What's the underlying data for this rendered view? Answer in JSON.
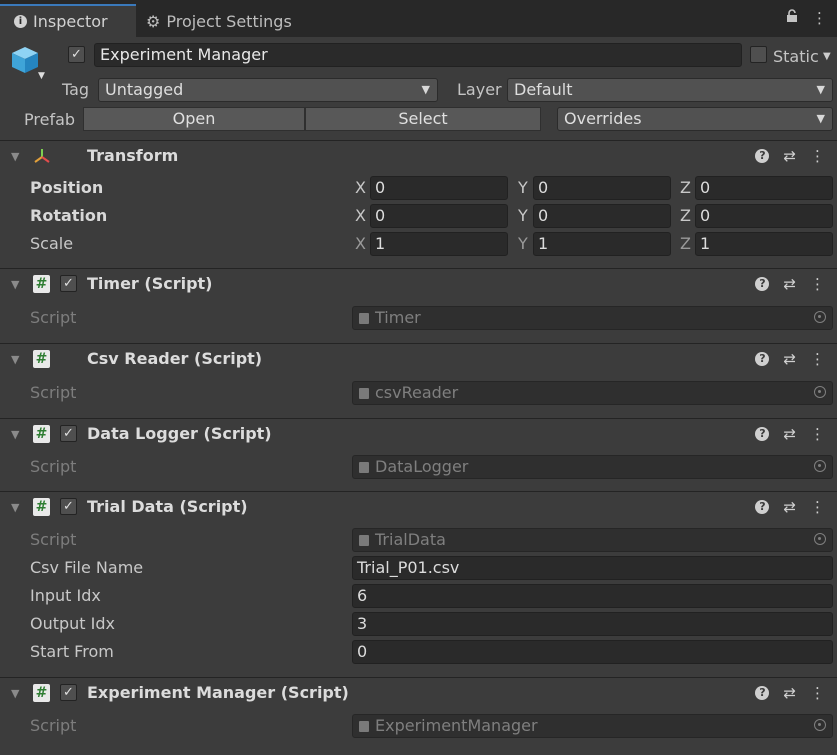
{
  "tabs": [
    {
      "label": "Inspector",
      "icon": "info-icon"
    },
    {
      "label": "Project Settings",
      "icon": "gear-icon"
    }
  ],
  "gameobject": {
    "name": "Experiment Manager",
    "active": true,
    "static_label": "Static",
    "tag_label": "Tag",
    "tag_value": "Untagged",
    "layer_label": "Layer",
    "layer_value": "Default",
    "prefab_label": "Prefab",
    "open_label": "Open",
    "select_label": "Select",
    "overrides_label": "Overrides"
  },
  "transform": {
    "title": "Transform",
    "position_label": "Position",
    "rotation_label": "Rotation",
    "scale_label": "Scale",
    "axes": {
      "x": "X",
      "y": "Y",
      "z": "Z"
    },
    "position": {
      "x": "0",
      "y": "0",
      "z": "0"
    },
    "rotation": {
      "x": "0",
      "y": "0",
      "z": "0"
    },
    "scale": {
      "x": "1",
      "y": "1",
      "z": "1"
    }
  },
  "script_label": "Script",
  "components": {
    "timer": {
      "title": "Timer (Script)",
      "enabled": true,
      "script": "Timer"
    },
    "csv_reader": {
      "title": "Csv Reader (Script)",
      "script": "csvReader"
    },
    "data_logger": {
      "title": "Data Logger (Script)",
      "enabled": true,
      "script": "DataLogger"
    },
    "trial_data": {
      "title": "Trial Data (Script)",
      "enabled": true,
      "script": "TrialData",
      "csv_file_name_label": "Csv File Name",
      "csv_file_name": "Trial_P01.csv",
      "input_idx_label": "Input Idx",
      "input_idx": "6",
      "output_idx_label": "Output Idx",
      "output_idx": "3",
      "start_from_label": "Start From",
      "start_from": "0"
    },
    "experiment_manager": {
      "title": "Experiment Manager (Script)",
      "enabled": true,
      "script": "ExperimentManager"
    }
  },
  "colors": {
    "background": "#383838",
    "accent_tab": "#3a79bb",
    "field": "#2a2a2a"
  }
}
